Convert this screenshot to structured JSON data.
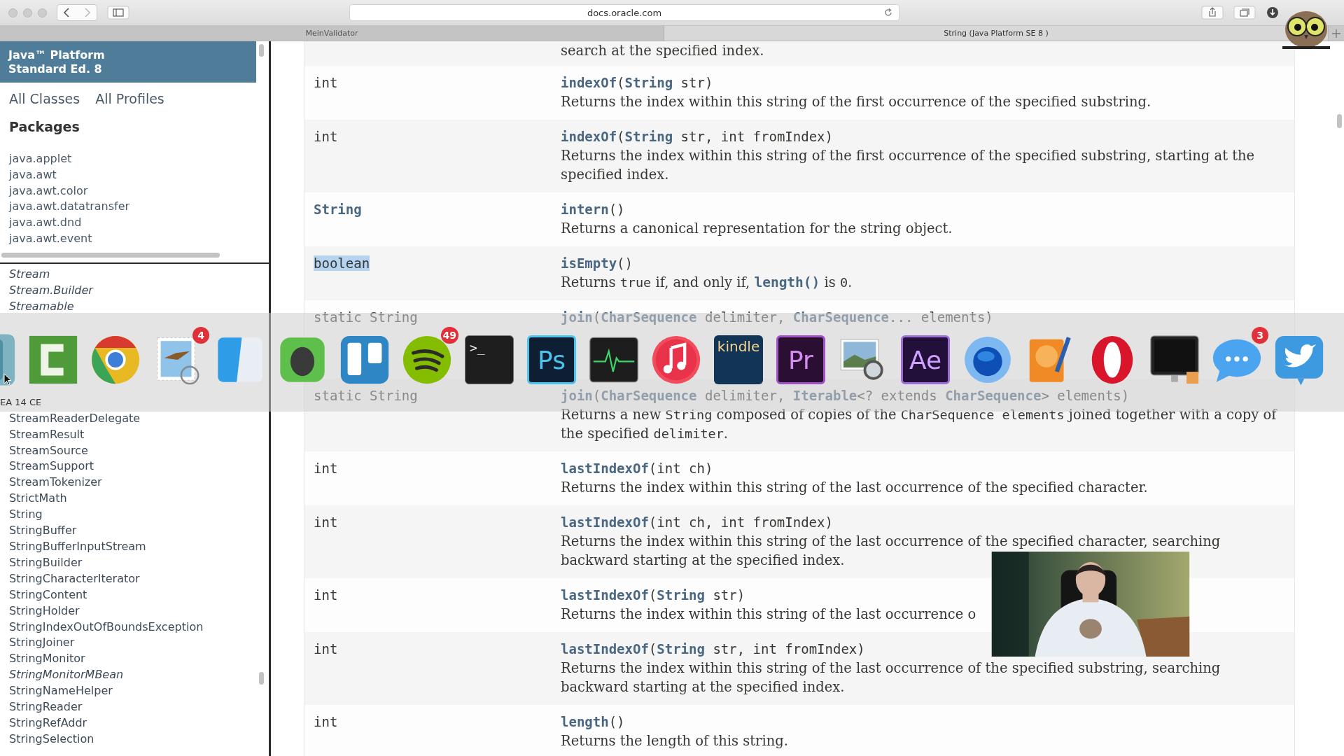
{
  "browser": {
    "url": "docs.oracle.com",
    "tabs": [
      {
        "label": "MeinValidator",
        "selected": false
      },
      {
        "label": "String (Java Platform SE 8 )",
        "selected": true
      }
    ]
  },
  "sidebar": {
    "header": [
      "Java™ Platform",
      "Standard Ed. 8"
    ],
    "links": [
      "All Classes",
      "All Profiles"
    ],
    "packages_heading": "Packages",
    "packages": [
      "java.applet",
      "java.awt",
      "java.awt.color",
      "java.awt.datatransfer",
      "java.awt.dnd",
      "java.awt.event"
    ],
    "classes_above": [
      {
        "name": "Stream",
        "interface": true
      },
      {
        "name": "Stream.Builder",
        "interface": true
      },
      {
        "name": "Streamable",
        "interface": true
      }
    ],
    "classes_below": [
      {
        "name": "StreamReaderDelegate",
        "interface": false
      },
      {
        "name": "StreamResult",
        "interface": false
      },
      {
        "name": "StreamSource",
        "interface": false
      },
      {
        "name": "StreamSupport",
        "interface": false
      },
      {
        "name": "StreamTokenizer",
        "interface": false
      },
      {
        "name": "StrictMath",
        "interface": false
      },
      {
        "name": "String",
        "interface": false
      },
      {
        "name": "StringBuffer",
        "interface": false
      },
      {
        "name": "StringBufferInputStream",
        "interface": false
      },
      {
        "name": "StringBuilder",
        "interface": false
      },
      {
        "name": "StringCharacterIterator",
        "interface": false
      },
      {
        "name": "StringContent",
        "interface": false
      },
      {
        "name": "StringHolder",
        "interface": false
      },
      {
        "name": "StringIndexOutOfBoundsException",
        "interface": false
      },
      {
        "name": "StringJoiner",
        "interface": false
      },
      {
        "name": "StringMonitor",
        "interface": false
      },
      {
        "name": "StringMonitorMBean",
        "interface": true
      },
      {
        "name": "StringNameHelper",
        "interface": false
      },
      {
        "name": "StringReader",
        "interface": false
      },
      {
        "name": "StringRefAddr",
        "interface": false
      },
      {
        "name": "StringSelection",
        "interface": false
      }
    ]
  },
  "methods": {
    "rows": [
      {
        "description": [
          {
            "kind": "text",
            "text": "search at the specified index."
          }
        ]
      },
      {
        "type": "int",
        "link": false,
        "highlighted": false,
        "signature": "**indexOf**(**String** str)",
        "description": [
          {
            "kind": "text",
            "text": "Returns the index within this string of the first occurrence of the specified substring."
          }
        ]
      },
      {
        "type": "int",
        "link": false,
        "highlighted": false,
        "signature": "**indexOf**(**String** str, int fromIndex)",
        "description": [
          {
            "kind": "text",
            "text": "Returns the index within this string of the first occurrence of the specified substring, starting at the specified index."
          }
        ]
      },
      {
        "type": "String",
        "link": true,
        "highlighted": false,
        "signature": "**intern**()",
        "description": [
          {
            "kind": "text",
            "text": "Returns a canonical representation for the string object."
          }
        ]
      },
      {
        "type": "boolean",
        "link": false,
        "highlighted": true,
        "signature": "**isEmpty**()",
        "description": [
          {
            "kind": "text",
            "text": "Returns "
          },
          {
            "kind": "code",
            "text": "true"
          },
          {
            "kind": "text",
            "text": " if, and only if, "
          },
          {
            "kind": "link",
            "text": "length()"
          },
          {
            "kind": "text",
            "text": " is "
          },
          {
            "kind": "code",
            "text": "0"
          },
          {
            "kind": "text",
            "text": "."
          }
        ]
      },
      {
        "type": "static String",
        "link": false,
        "highlighted": false,
        "signature": "**join**(**CharSequence** delimiter, **CharSequence**... elements)"
      },
      {
        "type": "static String",
        "link": false,
        "highlighted": false,
        "signature": "**join**(**CharSequence** delimiter, **Iterable**<? extends **CharSequence**> elements)",
        "description": [
          {
            "kind": "text",
            "text": "Returns a new "
          },
          {
            "kind": "code",
            "text": "String"
          },
          {
            "kind": "text",
            "text": " composed of copies of the "
          },
          {
            "kind": "code",
            "text": "CharSequence elements"
          },
          {
            "kind": "text",
            "text": " joined together with a copy of the specified "
          },
          {
            "kind": "code",
            "text": "delimiter"
          },
          {
            "kind": "text",
            "text": "."
          }
        ]
      },
      {
        "type": "int",
        "link": false,
        "highlighted": false,
        "signature": "**lastIndexOf**(int ch)",
        "description": [
          {
            "kind": "text",
            "text": "Returns the index within this string of the last occurrence of the specified character."
          }
        ]
      },
      {
        "type": "int",
        "link": false,
        "highlighted": false,
        "signature": "**lastIndexOf**(int ch, int fromIndex)",
        "description": [
          {
            "kind": "text",
            "text": "Returns the index within this string of the last occurrence of the specified character, searching backward starting at the specified index."
          }
        ]
      },
      {
        "type": "int",
        "link": false,
        "highlighted": false,
        "signature": "**lastIndexOf**(**String** str)",
        "description": [
          {
            "kind": "text",
            "text": "Returns the index within this string of the last occurrence o"
          }
        ]
      },
      {
        "type": "int",
        "link": false,
        "highlighted": false,
        "signature": "**lastIndexOf**(**String** str, int fromIndex)",
        "description": [
          {
            "kind": "text",
            "text": "Returns the index within this string of the last occurrence of the specified substring, searching backward starting at the specified index."
          }
        ]
      },
      {
        "type": "int",
        "link": false,
        "highlighted": false,
        "signature": "**length**()",
        "description": [
          {
            "kind": "text",
            "text": "Returns the length of this string."
          }
        ]
      }
    ]
  },
  "dock": {
    "label": "EA 14 CE",
    "items": [
      {
        "kind": "intellij"
      },
      {
        "kind": "camtasia"
      },
      {
        "kind": "chrome"
      },
      {
        "kind": "mail",
        "badge": "4"
      },
      {
        "kind": "finder"
      },
      {
        "kind": "evernote"
      },
      {
        "kind": "trello"
      },
      {
        "kind": "spotify",
        "badge": "49"
      },
      {
        "kind": "terminal",
        "label": ">_"
      },
      {
        "kind": "photoshop",
        "label": "Ps"
      },
      {
        "kind": "activity"
      },
      {
        "kind": "itunes"
      },
      {
        "kind": "kindle",
        "label": "kindle"
      },
      {
        "kind": "premiere",
        "label": "Pr"
      },
      {
        "kind": "preview"
      },
      {
        "kind": "aftereffects",
        "label": "Ae"
      },
      {
        "kind": "bluering"
      },
      {
        "kind": "ibooks"
      },
      {
        "kind": "opera"
      },
      {
        "kind": "screen"
      },
      {
        "kind": "messages",
        "badge": "3"
      },
      {
        "kind": "twitter"
      }
    ]
  }
}
